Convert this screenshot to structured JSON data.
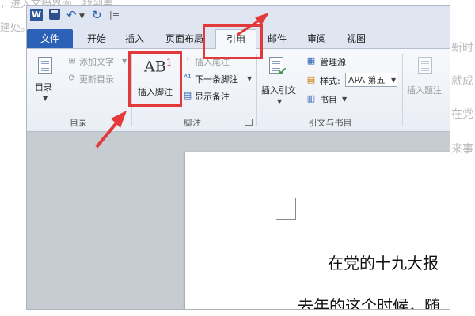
{
  "background_text": {
    "top_line": "，进入文档界面，找到要",
    "top_line2": "建处。",
    "right_lines": [
      "新时",
      "就成",
      "在党",
      "来事"
    ]
  },
  "qat": {
    "logo": "W",
    "separator": "|="
  },
  "tabs": [
    {
      "label": "文件"
    },
    {
      "label": "开始"
    },
    {
      "label": "插入"
    },
    {
      "label": "页面布局"
    },
    {
      "label": "引用"
    },
    {
      "label": "邮件"
    },
    {
      "label": "审阅"
    },
    {
      "label": "视图"
    }
  ],
  "ribbon": {
    "toc": {
      "label": "目录",
      "add_text": "添加文字",
      "update_toc": "更新目录",
      "group_label": "目录"
    },
    "footnotes": {
      "insert_footnote_icon": "AB",
      "insert_footnote_sup": "1",
      "insert_footnote": "插入脚注",
      "insert_endnote": "插入尾注",
      "next_footnote": "下一条脚注",
      "show_notes": "显示备注",
      "group_label": "脚注"
    },
    "citations": {
      "insert_citation_line1": "插入引文",
      "manage_sources": "管理源",
      "style_label": "样式:",
      "style_value": "APA 第五",
      "bibliography": "书目",
      "group_label": "引文与书目"
    },
    "captions": {
      "insert_caption": "插入题注"
    }
  },
  "document": {
    "line1": "在党的十九大报",
    "line2": "去年的这个时候，随"
  },
  "colors": {
    "file_tab": "#2b62b7",
    "highlight": "#e23a3a"
  }
}
